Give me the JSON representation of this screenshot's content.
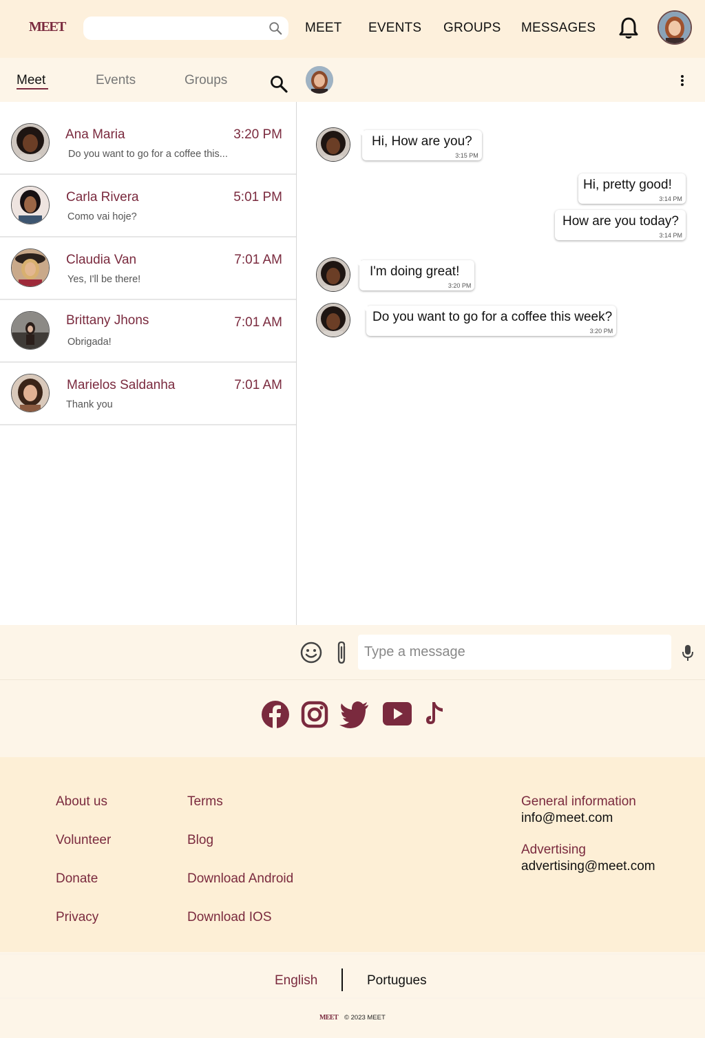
{
  "brand": {
    "logo_text": "MEET",
    "accent": "#7a2a3e"
  },
  "header": {
    "search_placeholder": "",
    "nav": [
      "MEET",
      "EVENTS",
      "GROUPS",
      "MESSAGES"
    ]
  },
  "subbar": {
    "tabs": [
      "Meet",
      "Events",
      "Groups"
    ],
    "active_tab": "Meet"
  },
  "conversations": [
    {
      "name": "Ana Maria",
      "time": "3:20 PM",
      "preview": "Do you want to go for a coffee this..."
    },
    {
      "name": "Carla Rivera",
      "time": "5:01 PM",
      "preview": "Como vai hoje?"
    },
    {
      "name": "Claudia Van",
      "time": "7:01 AM",
      "preview": "Yes, I'll be there!"
    },
    {
      "name": "Brittany Jhons",
      "time": "7:01 AM",
      "preview": "Obrigada!"
    },
    {
      "name": "Marielos Saldanha",
      "time": "7:01 AM",
      "preview": "Thank you"
    }
  ],
  "messages": [
    {
      "direction": "in",
      "text": "Hi, How are you?",
      "time": "3:15 PM"
    },
    {
      "direction": "out",
      "text": "Hi, pretty good!",
      "time": "3:14 PM"
    },
    {
      "direction": "out",
      "text": "How are you today?",
      "time": "3:14 PM"
    },
    {
      "direction": "in",
      "text": "I'm doing great!",
      "time": "3:20 PM"
    },
    {
      "direction": "in",
      "text": "Do you want to go for a coffee this week?",
      "time": "3:20 PM"
    }
  ],
  "composer": {
    "placeholder": "Type a message"
  },
  "social": [
    "facebook-icon",
    "instagram-icon",
    "twitter-icon",
    "youtube-icon",
    "tiktok-icon"
  ],
  "footer": {
    "col1": [
      "About us",
      "Volunteer",
      "Donate",
      "Privacy"
    ],
    "col2": [
      "Terms",
      "Blog",
      "Download Android",
      "Download IOS"
    ],
    "contact": [
      {
        "label": "General information",
        "email": "info@meet.com"
      },
      {
        "label": "Advertising",
        "email": "advertising@meet.com"
      }
    ]
  },
  "languages": {
    "current": "English",
    "other": "Portugues"
  },
  "copyright": {
    "logo_text": "MEET",
    "text": "© 2023 MEET"
  }
}
